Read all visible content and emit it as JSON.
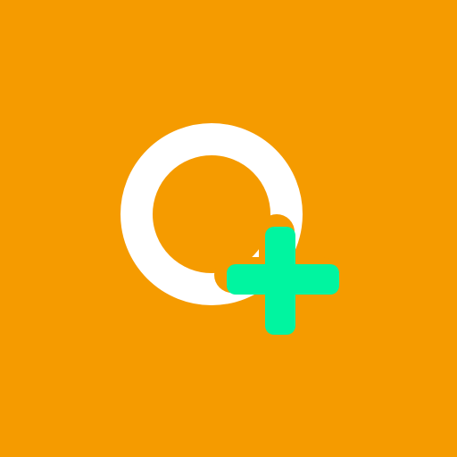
{
  "icon": {
    "name": "add-ring-icon",
    "colors": {
      "background": "#F59B00",
      "ring": "#FFFFFF",
      "plus": "#00F5A0"
    }
  }
}
